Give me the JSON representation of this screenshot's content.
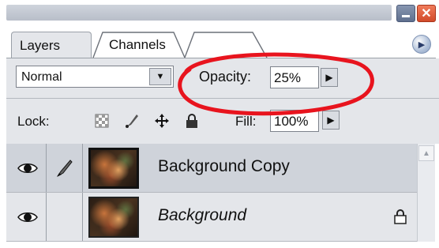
{
  "window": {
    "minimize_icon": "minimize-icon",
    "close_icon": "close-icon",
    "close_glyph": "✕"
  },
  "tabs": [
    {
      "label": "Layers",
      "active": true
    },
    {
      "label": "Channels",
      "active": false
    }
  ],
  "panel_menu_icon": "panel-menu-arrow-icon",
  "blend_mode": {
    "value": "Normal",
    "icon": "chevron-down-icon"
  },
  "opacity": {
    "label": "Opacity:",
    "value": "25%",
    "icon": "triangle-right-icon"
  },
  "lock": {
    "label": "Lock:",
    "icons": [
      "lock-transparent-pixels-icon",
      "lock-image-pixels-icon",
      "lock-position-icon",
      "lock-all-icon"
    ]
  },
  "fill": {
    "label": "Fill:",
    "value": "100%",
    "icon": "triangle-right-icon"
  },
  "annotation": {
    "color": "#e8141e",
    "target": "opacity"
  },
  "layers": [
    {
      "name": "Background Copy",
      "visible": true,
      "selected": true,
      "brush": true,
      "locked": false
    },
    {
      "name": "Background",
      "visible": true,
      "selected": false,
      "brush": false,
      "locked": true
    }
  ],
  "colors": {
    "selected_row": "#cfd3da",
    "panel_bg": "#e4e6ea",
    "close_button": "#d24a2a"
  }
}
